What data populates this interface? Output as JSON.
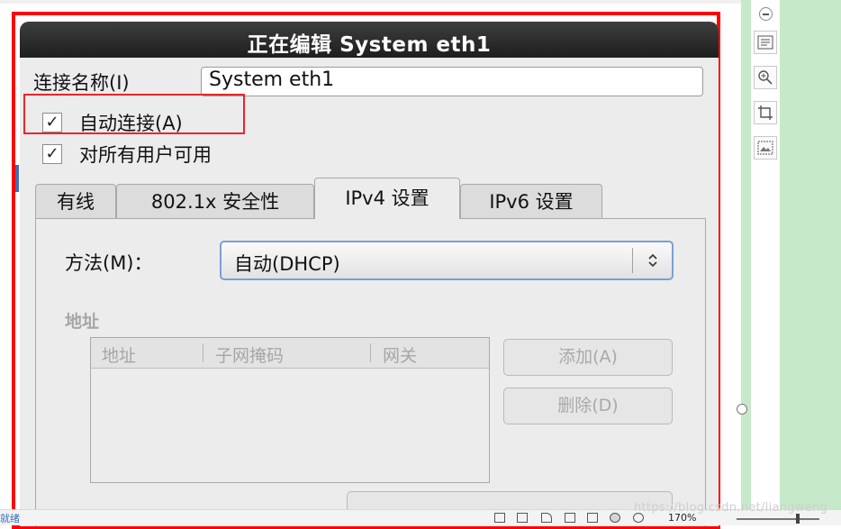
{
  "dialog": {
    "title": "正在编辑 System eth1",
    "connection_name_label": "连接名称(I)",
    "connection_name_value": "System eth1",
    "auto_connect_label": "自动连接(A)",
    "auto_connect_checked": true,
    "all_users_label": "对所有用户可用",
    "all_users_checked": true,
    "check_mark": "✓"
  },
  "tabs": [
    {
      "label": "有线",
      "active": false
    },
    {
      "label": "802.1x 安全性",
      "active": false
    },
    {
      "label": "IPv4 设置",
      "active": true
    },
    {
      "label": "IPv6 设置",
      "active": false
    }
  ],
  "ipv4": {
    "method_label": "方法(M)：",
    "method_value": "自动(DHCP)",
    "method_arrows": "⌃⌄",
    "address_section": "地址",
    "columns": [
      "地址",
      "子网掩码",
      "网关"
    ],
    "add_button": "添加(A)",
    "delete_button": "删除(D)"
  },
  "status_bar": {
    "left_text": "就绪",
    "zoom": "170%",
    "watermark": "https://blog.csdn.net/liangweng"
  },
  "colors": {
    "highlight_frame": "#ff0000",
    "side_pane": "#c6e9c9",
    "title_bar": "#2a2a2a"
  },
  "icons": [
    "collapse-icon",
    "outline-icon",
    "zoom-icon",
    "crop-icon",
    "image-settings-icon"
  ]
}
